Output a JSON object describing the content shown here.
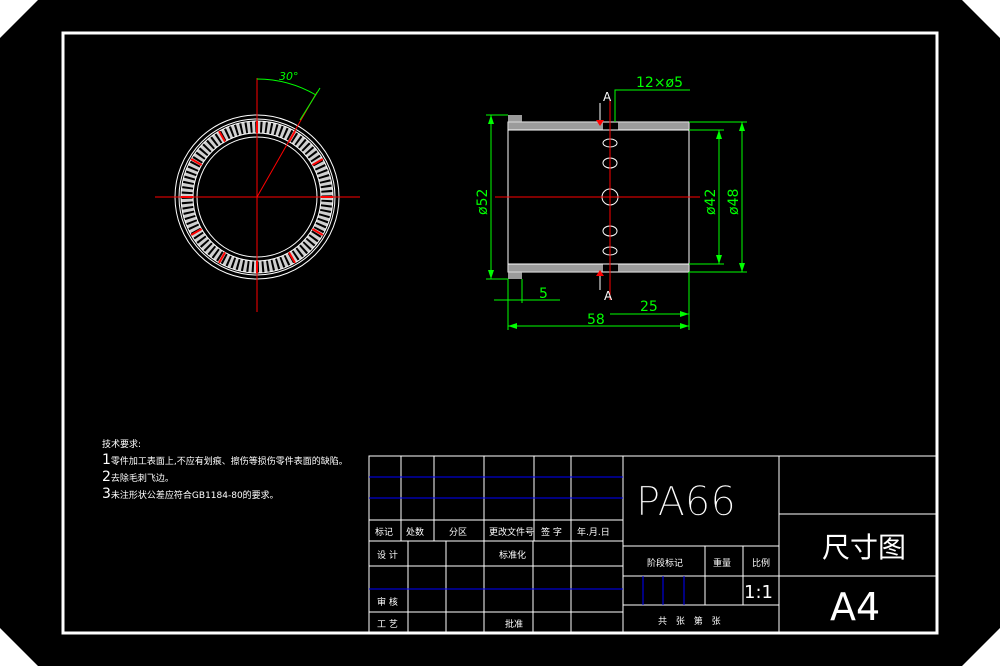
{
  "colors": {
    "background": "#000000",
    "paper": "#ffffff",
    "line": "#ffffff",
    "dimension": "#00ff00",
    "center": "#ff0000",
    "blue": "#0000ff",
    "hatch": "#cfcfcf"
  },
  "drawing": {
    "angle_label": "30°",
    "section_mark_top": "A",
    "section_mark_bottom": "A",
    "holes_label": "12×ø5",
    "dia_outer_left": "ø52",
    "dia_inner": "ø42",
    "dia_outer_right": "ø48",
    "dim_5": "5",
    "dim_25": "25",
    "dim_58": "58"
  },
  "notes": {
    "title": "技术要求:",
    "line1_num": "1",
    "line1": "零件加工表面上,不应有划痕、擦伤等损伤零件表面的缺陷。",
    "line2_num": "2",
    "line2": "去除毛刺飞边。",
    "line3_num": "3",
    "line3": "未注形状公差应符合GB1184-80的要求。"
  },
  "title_block": {
    "material": "PA66",
    "drawing_name": "尺寸图",
    "sheet_size": "A4",
    "h_mark": "标记",
    "h_count": "处数",
    "h_zone": "分区",
    "h_doc": "更改文件号",
    "h_sign": "签 字",
    "h_date": "年.月.日",
    "design": "设 计",
    "standard": "标准化",
    "review": "审 核",
    "process": "工 艺",
    "approve": "批准",
    "stage": "阶段标记",
    "weight": "重量",
    "scale_label": "比例",
    "scale": "1:1",
    "sheets": "共 张 第 张"
  }
}
